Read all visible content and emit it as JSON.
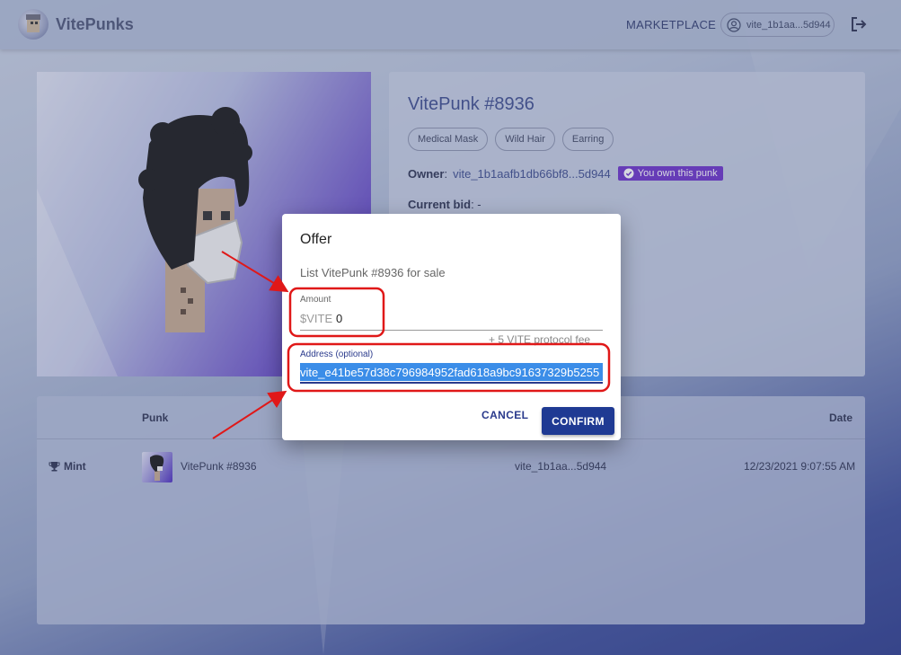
{
  "header": {
    "brand": "VitePunks",
    "nav_marketplace": "MARKETPLACE",
    "account": "vite_1b1aa...5d944"
  },
  "punk": {
    "title": "VitePunk #8936",
    "traits": [
      "Medical Mask",
      "Wild Hair",
      "Earring"
    ],
    "owner_label": "Owner",
    "owner_address": "vite_1b1aafb1db66bf8...5d944",
    "own_badge": "You own this punk",
    "bid_label": "Current bid",
    "bid_value": "-"
  },
  "history": {
    "columns": {
      "punk": "Punk",
      "date": "Date"
    },
    "rows": [
      {
        "event": "Mint",
        "punk": "VitePunk #8936",
        "address": "vite_1b1aa...5d944",
        "date": "12/23/2021 9:07:55 AM"
      }
    ]
  },
  "dialog": {
    "title": "Offer",
    "subtitle": "List VitePunk #8936 for sale",
    "amount_label": "Amount",
    "amount_prefix": "$VITE",
    "amount_value": "0",
    "fee_hint": "+ 5 VITE protocol fee",
    "address_label": "Address (optional)",
    "address_value": "vite_e41be57d38c796984952fad618a9bc91637329b5255",
    "cancel_label": "CANCEL",
    "confirm_label": "CONFIRM"
  },
  "colors": {
    "primary": "#1f3a93",
    "badge": "#6a2fc9",
    "selection": "#3b8de8",
    "annotation": "#e01818"
  }
}
